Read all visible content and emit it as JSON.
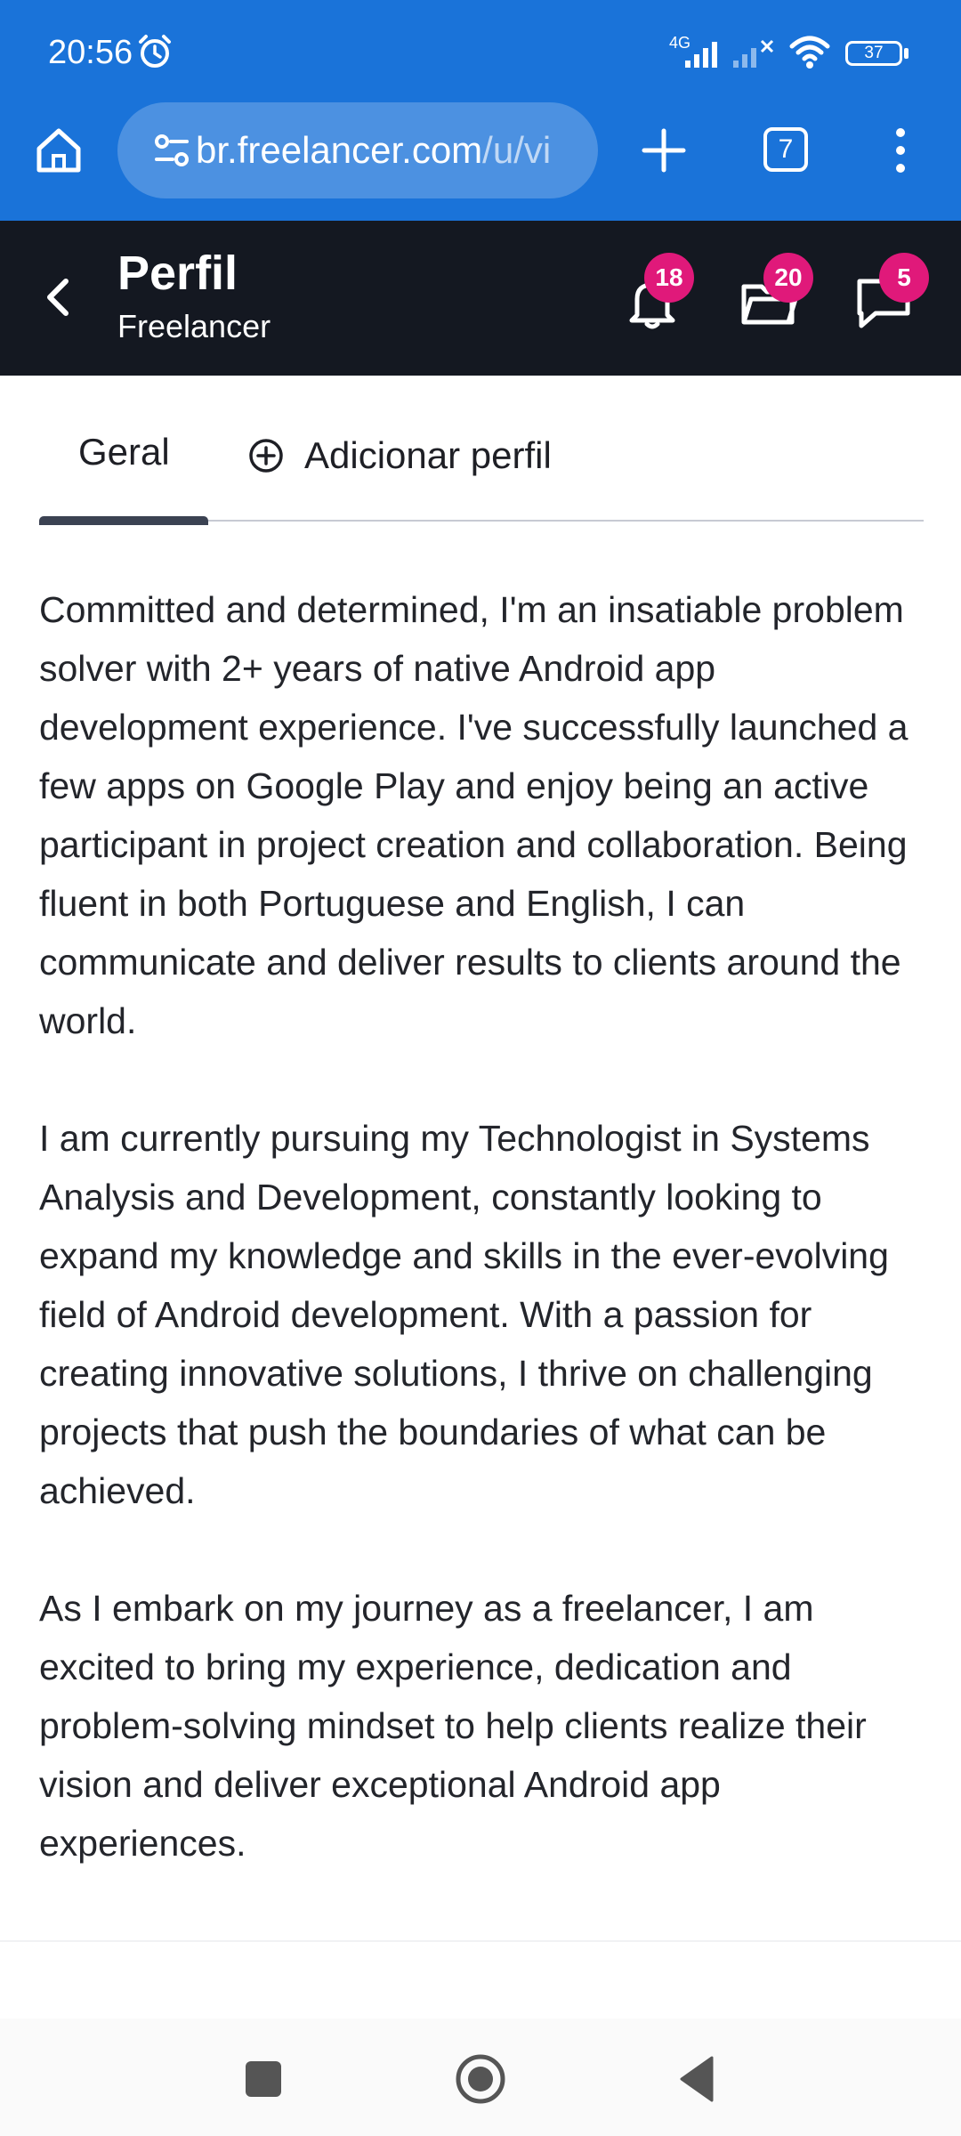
{
  "status_bar": {
    "time": "20:56",
    "network": "4G",
    "battery": "37",
    "icons": [
      "alarm-icon",
      "signal-icon",
      "signal-x-icon",
      "wifi-icon",
      "battery-icon"
    ]
  },
  "browser": {
    "url_host": "br.freelancer.com",
    "url_path": "/u/vi",
    "tab_count": "7",
    "icons": [
      "home-icon",
      "site-settings-icon",
      "plus-icon",
      "more-vert-icon"
    ]
  },
  "header": {
    "title": "Perfil",
    "subtitle": "Freelancer",
    "notifications_count": "18",
    "projects_count": "20",
    "messages_count": "5"
  },
  "tabs": {
    "general": "Geral",
    "add_profile": "Adicionar perfil"
  },
  "about": {
    "paragraphs": [
      "Committed and determined, I'm an insatiable problem solver with 2+ years of native Android app development experience. I've successfully launched a few apps on Google Play and enjoy being an active participant in project creation and collaboration. Being fluent in both Portuguese and English, I can communicate and deliver results to clients around the world.",
      "I am currently pursuing my Technologist in Systems Analysis and Development, constantly looking to expand my knowledge and skills in the ever-evolving field of Android development. With a passion for creating innovative solutions, I thrive on challenging projects that push the boundaries of what can be achieved.",
      "As I embark on my journey as a freelancer, I am excited to bring my experience, dedication and problem-solving mindset to help clients realize their vision and deliver exceptional Android app experiences."
    ]
  },
  "colors": {
    "browser_bar": "#1a73d9",
    "app_header": "#141821",
    "badge": "#e0197a"
  }
}
